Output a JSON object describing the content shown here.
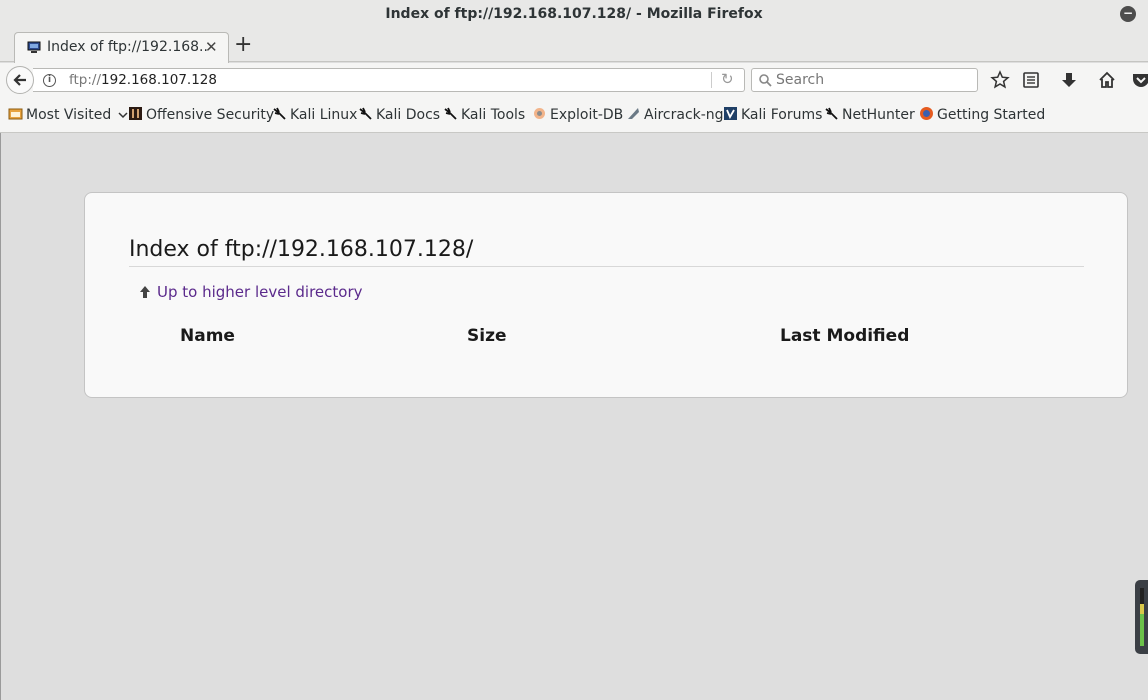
{
  "window": {
    "title": "Index of ftp://192.168.107.128/ - Mozilla Firefox"
  },
  "tab": {
    "title": "Index of ftp://192.168..."
  },
  "navbar": {
    "url_scheme": "ftp://",
    "url_host": "192.168.107.128",
    "search_placeholder": "Search"
  },
  "bookmarks": [
    {
      "label": "Most Visited",
      "icon": "folder-icon"
    },
    {
      "label": "Offensive Security",
      "icon": "offsec-icon"
    },
    {
      "label": "Kali Linux",
      "icon": "kali-dragon-icon"
    },
    {
      "label": "Kali Docs",
      "icon": "kali-dragon-icon"
    },
    {
      "label": "Kali Tools",
      "icon": "kali-dragon-icon"
    },
    {
      "label": "Exploit-DB",
      "icon": "exploitdb-icon"
    },
    {
      "label": "Aircrack-ng",
      "icon": "aircrack-icon"
    },
    {
      "label": "Kali Forums",
      "icon": "kali-forums-icon"
    },
    {
      "label": "NetHunter",
      "icon": "kali-dragon-icon"
    },
    {
      "label": "Getting Started",
      "icon": "firefox-icon"
    }
  ],
  "page": {
    "heading": "Index of ftp://192.168.107.128/",
    "up_link": "Up to higher level directory",
    "columns": [
      "Name",
      "Size",
      "Last Modified"
    ]
  }
}
